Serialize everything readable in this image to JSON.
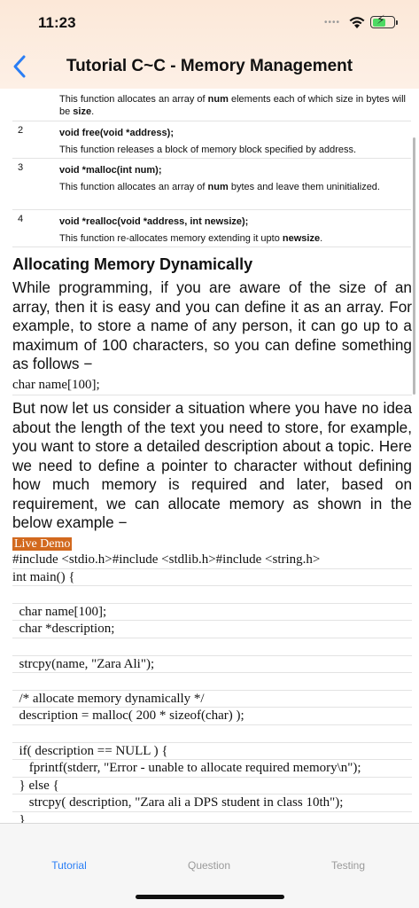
{
  "status_bar": {
    "time": "11:23",
    "signal_dots": "••••"
  },
  "nav": {
    "title": "Tutorial C~C - Memory Management"
  },
  "functions": [
    {
      "num": "",
      "signature": "",
      "description_parts": [
        "This function allocates an array of ",
        "num",
        " elements each of which size in bytes will be ",
        "size",
        "."
      ]
    },
    {
      "num": "2",
      "signature": "void free(void *address);",
      "description_parts": [
        "This function releases a block of memory block specified by address."
      ]
    },
    {
      "num": "3",
      "signature": "void *malloc(int num);",
      "description_parts": [
        "This function allocates an array of ",
        "num",
        " bytes and leave them uninitialized."
      ]
    },
    {
      "num": "4",
      "signature": "void *realloc(void *address, int newsize);",
      "description_parts": [
        "This function re-allocates memory extending it upto ",
        "newsize",
        "."
      ]
    }
  ],
  "section": {
    "heading": "Allocating Memory Dynamically",
    "para1": "While programming, if you are aware of the size of an array, then it is easy and you can define it as an array. For example, to store a name of any person, it can go up to a maximum of 100 characters, so you can define something as follows −",
    "inline_code": "char name[100];",
    "para2": "But now let us consider a situation where you have no idea about the length of the text you need to store, for example, you want to store a detailed description about a topic. Here we need to define a pointer to character without defining how much memory is required and later, based on requirement, we can allocate memory as shown in the below example −",
    "live_demo": "Live Demo"
  },
  "code_lines": [
    "#include <stdio.h>#include <stdlib.h>#include <string.h>",
    "int main() {",
    "",
    "  char name[100];",
    "  char *description;",
    "",
    "  strcpy(name, \"Zara Ali\");",
    "",
    "  /* allocate memory dynamically */",
    "  description = malloc( 200 * sizeof(char) );",
    "",
    "  if( description == NULL ) {",
    "     fprintf(stderr, \"Error - unable to allocate required memory\\n\");",
    "  } else {",
    "     strcpy( description, \"Zara ali a DPS student in class 10th\");",
    "  }"
  ],
  "tabs": [
    {
      "label": "Tutorial",
      "active": true
    },
    {
      "label": "Question",
      "active": false
    },
    {
      "label": "Testing",
      "active": false
    }
  ],
  "colors": {
    "accent": "#2a7ef5",
    "live_demo_bg": "#d2691e",
    "battery": "#4cd964"
  }
}
